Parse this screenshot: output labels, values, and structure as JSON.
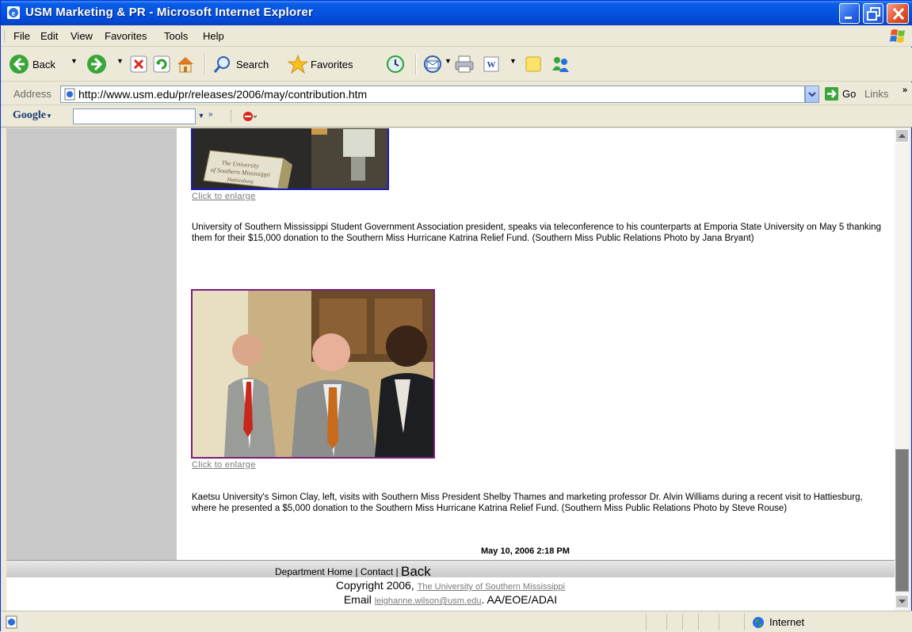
{
  "window": {
    "title": "USM Marketing & PR - Microsoft Internet Explorer"
  },
  "menu": [
    "File",
    "Edit",
    "View",
    "Favorites",
    "Tools",
    "Help"
  ],
  "toolbar": {
    "back": "Back",
    "search": "Search",
    "favorites": "Favorites"
  },
  "address": {
    "label": "Address",
    "url": "http://www.usm.edu/pr/releases/2006/may/contribution.htm",
    "go": "Go",
    "links": "Links"
  },
  "google": {
    "logo": "Google"
  },
  "content": {
    "photo1_link": "Click to enlarge",
    "caption1": "University of Southern Mississippi Student Government Association president, speaks via teleconference to his counterparts at Emporia State University on May 5 thanking them for their $15,000 donation to the Southern Miss Hurricane Katrina Relief Fund. (Southern Miss Public Relations Photo by Jana Bryant)",
    "photo2_link": "Click to enlarge",
    "caption2": "Kaetsu University's Simon Clay, left, visits with Southern Miss President Shelby Thames and marketing professor Dr. Alvin Williams during a recent visit to Hattiesburg, where he presented a $5,000 donation to the Southern Miss Hurricane Katrina Relief Fund. (Southern Miss Public Relations Photo by Steve Rouse)",
    "date": "May 10, 2006 2:18 PM"
  },
  "footer": {
    "department_home": "Department Home",
    "sep1": " | ",
    "contact": "Contact",
    "sep2": " | ",
    "back": "Back",
    "copyright_prefix": "Copyright 2006, ",
    "university_link": "The University of Southern Mississippi",
    "email_prefix": "Email  ",
    "email_link": "leighanne.wilson@usm.edu",
    "email_suffix": ". AA/EOE/ADAI"
  },
  "status": {
    "zone": "Internet"
  }
}
